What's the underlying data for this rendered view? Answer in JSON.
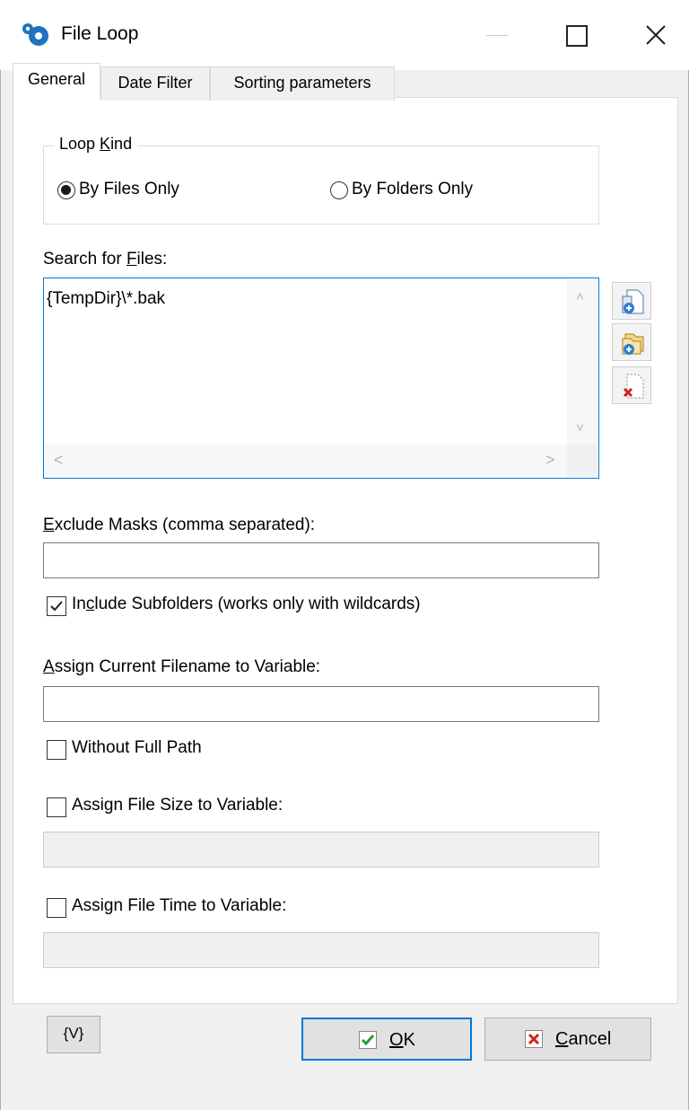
{
  "window": {
    "title": "File Loop"
  },
  "tabs": [
    {
      "label": "General",
      "selected": true
    },
    {
      "label": "Date Filter",
      "selected": false
    },
    {
      "label": "Sorting parameters",
      "selected": false
    }
  ],
  "loop_kind": {
    "legend_pre": "Loop ",
    "legend_key": "K",
    "legend_post": "ind",
    "options": [
      {
        "label": "By Files Only",
        "selected": true
      },
      {
        "label": "By Folders Only",
        "selected": false
      }
    ]
  },
  "search_files": {
    "label_pre": "Search for ",
    "label_key": "F",
    "label_post": "iles:",
    "value": "{TempDir}\\*.bak"
  },
  "exclude_masks": {
    "label_key": "E",
    "label_post": "xclude Masks (comma separated):",
    "value": ""
  },
  "include_subfolders": {
    "label_pre": "In",
    "label_key": "c",
    "label_post": "lude Subfolders (works only with wildcards)",
    "checked": true
  },
  "assign_filename": {
    "label_key": "A",
    "label_post": "ssign Current Filename to Variable:",
    "value": ""
  },
  "without_full_path": {
    "label": "Without Full Path",
    "checked": false
  },
  "assign_size": {
    "label": "Assign File Size to Variable:",
    "checked": false,
    "value": ""
  },
  "assign_time": {
    "label": "Assign File Time to Variable:",
    "checked": false,
    "value": ""
  },
  "buttons": {
    "vars": "{V}",
    "ok_key": "O",
    "ok_post": "K",
    "cancel_key": "C",
    "cancel_post": "ancel"
  },
  "colors": {
    "accent": "#0078d7",
    "ok_check": "#2a9d2a",
    "cancel_x": "#d42020"
  }
}
